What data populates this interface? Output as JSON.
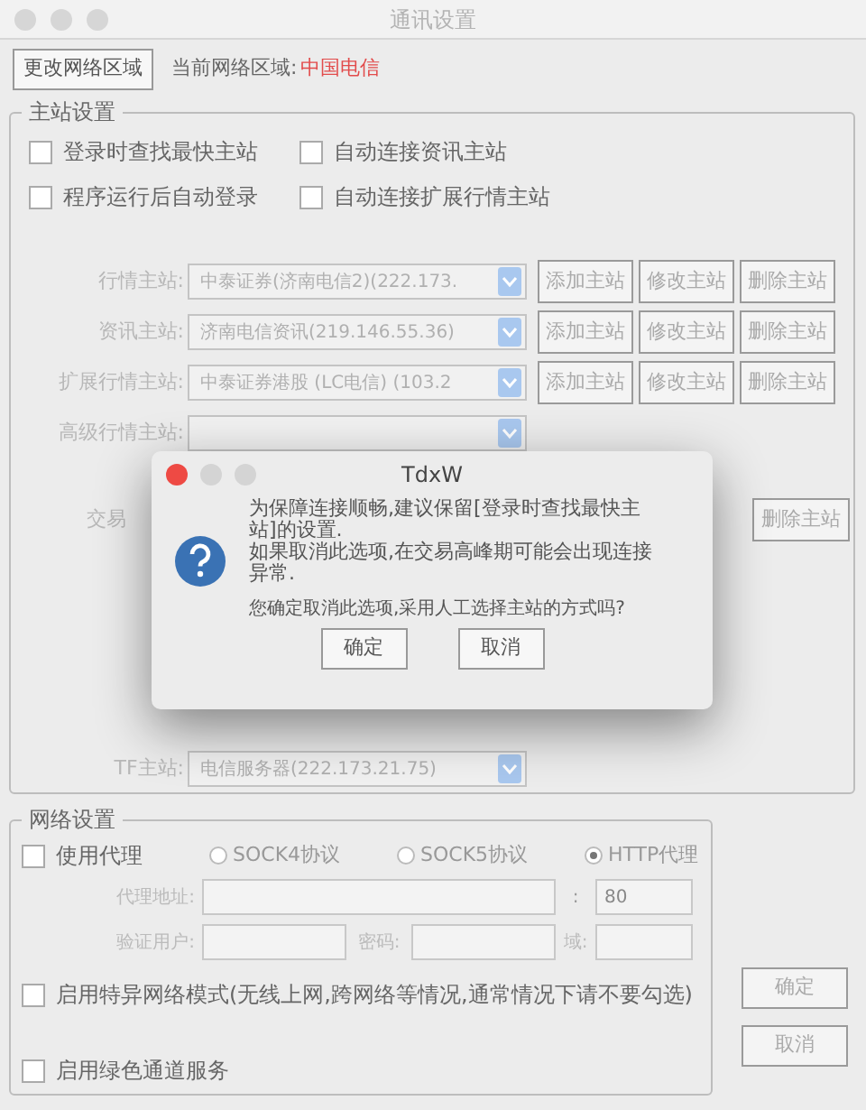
{
  "window": {
    "title": "通讯设置"
  },
  "region": {
    "button": "更改网络区域",
    "label": "当前网络区域:",
    "value": "中国电信"
  },
  "master": {
    "title": "主站设置",
    "checkboxes": [
      {
        "label": "登录时查找最快主站",
        "checked": false
      },
      {
        "label": "自动连接资讯主站",
        "checked": false
      },
      {
        "label": "程序运行后自动登录",
        "checked": false
      },
      {
        "label": "自动连接扩展行情主站",
        "checked": false
      }
    ],
    "servers": [
      {
        "kind": "full",
        "label": "行情主站:",
        "value": "中泰证券(济南电信2)(222.173.",
        "buttons": [
          "添加主站",
          "修改主站",
          "删除主站"
        ]
      },
      {
        "kind": "full",
        "label": "资讯主站:",
        "value": "济南电信资讯(219.146.55.36)",
        "buttons": [
          "添加主站",
          "修改主站",
          "删除主站"
        ]
      },
      {
        "kind": "full",
        "label": "扩展行情主站:",
        "value": "中泰证券港股 (LC电信) (103.2",
        "buttons": [
          "添加主站",
          "修改主站",
          "删除主站"
        ]
      },
      {
        "kind": "combo",
        "label": "高级行情主站:"
      },
      {
        "kind": "covered",
        "label": "交易",
        "buttons": [
          "删除主站"
        ]
      },
      {
        "kind": "full",
        "label": "TF主站:",
        "value": "电信服务器(222.173.21.75)"
      }
    ]
  },
  "network": {
    "title": "网络设置",
    "proxy": {
      "label": "使用代理",
      "checked": false
    },
    "protocols": [
      {
        "label": "SOCK4协议",
        "selected": false
      },
      {
        "label": "SOCK5协议",
        "selected": false
      },
      {
        "label": "HTTP代理",
        "selected": true
      }
    ],
    "address_label": "代理地址:",
    "port_separator": ":",
    "port_value": "80",
    "user_label": "验证用户:",
    "password_label": "密码:",
    "domain_label": "域:",
    "options": [
      {
        "label": "启用特异网络模式(无线上网,跨网络等情况,通常情况下请不要勾选)",
        "checked": false
      },
      {
        "label": "启用绿色通道服务",
        "checked": false
      }
    ]
  },
  "buttons": [
    "确定",
    "取消"
  ],
  "dialog": {
    "title": "TdxW",
    "paragraphs": [
      "为保障连接顺畅,建议保留[登录时查找最快主站]的设置.",
      "如果取消此选项,在交易高峰期可能会出现连接异常.",
      "您确定取消此选项,采用人工选择主站的方式吗?"
    ],
    "buttons": [
      "确定",
      "取消"
    ]
  }
}
